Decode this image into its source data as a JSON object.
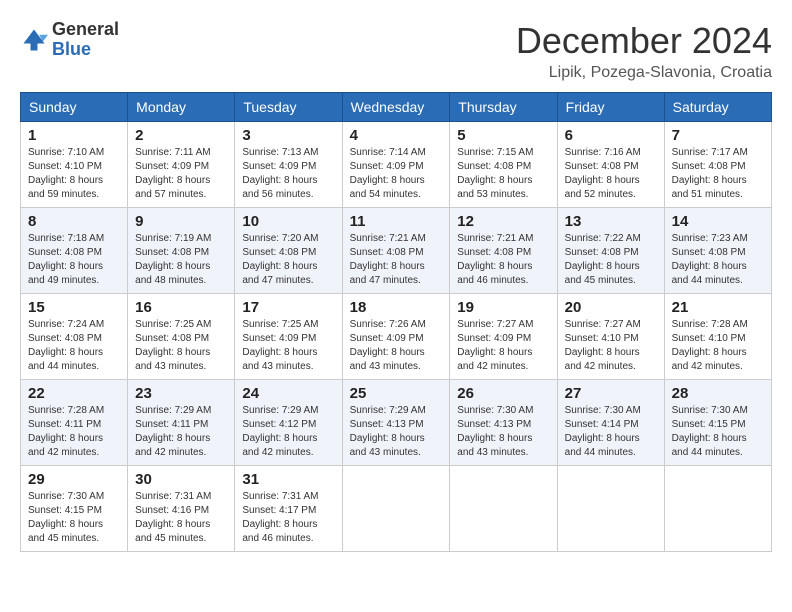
{
  "logo": {
    "general": "General",
    "blue": "Blue"
  },
  "title": "December 2024",
  "location": "Lipik, Pozega-Slavonia, Croatia",
  "days_of_week": [
    "Sunday",
    "Monday",
    "Tuesday",
    "Wednesday",
    "Thursday",
    "Friday",
    "Saturday"
  ],
  "weeks": [
    [
      {
        "day": "1",
        "sunrise": "7:10 AM",
        "sunset": "4:10 PM",
        "daylight": "8 hours and 59 minutes."
      },
      {
        "day": "2",
        "sunrise": "7:11 AM",
        "sunset": "4:09 PM",
        "daylight": "8 hours and 57 minutes."
      },
      {
        "day": "3",
        "sunrise": "7:13 AM",
        "sunset": "4:09 PM",
        "daylight": "8 hours and 56 minutes."
      },
      {
        "day": "4",
        "sunrise": "7:14 AM",
        "sunset": "4:09 PM",
        "daylight": "8 hours and 54 minutes."
      },
      {
        "day": "5",
        "sunrise": "7:15 AM",
        "sunset": "4:08 PM",
        "daylight": "8 hours and 53 minutes."
      },
      {
        "day": "6",
        "sunrise": "7:16 AM",
        "sunset": "4:08 PM",
        "daylight": "8 hours and 52 minutes."
      },
      {
        "day": "7",
        "sunrise": "7:17 AM",
        "sunset": "4:08 PM",
        "daylight": "8 hours and 51 minutes."
      }
    ],
    [
      {
        "day": "8",
        "sunrise": "7:18 AM",
        "sunset": "4:08 PM",
        "daylight": "8 hours and 49 minutes."
      },
      {
        "day": "9",
        "sunrise": "7:19 AM",
        "sunset": "4:08 PM",
        "daylight": "8 hours and 48 minutes."
      },
      {
        "day": "10",
        "sunrise": "7:20 AM",
        "sunset": "4:08 PM",
        "daylight": "8 hours and 47 minutes."
      },
      {
        "day": "11",
        "sunrise": "7:21 AM",
        "sunset": "4:08 PM",
        "daylight": "8 hours and 47 minutes."
      },
      {
        "day": "12",
        "sunrise": "7:21 AM",
        "sunset": "4:08 PM",
        "daylight": "8 hours and 46 minutes."
      },
      {
        "day": "13",
        "sunrise": "7:22 AM",
        "sunset": "4:08 PM",
        "daylight": "8 hours and 45 minutes."
      },
      {
        "day": "14",
        "sunrise": "7:23 AM",
        "sunset": "4:08 PM",
        "daylight": "8 hours and 44 minutes."
      }
    ],
    [
      {
        "day": "15",
        "sunrise": "7:24 AM",
        "sunset": "4:08 PM",
        "daylight": "8 hours and 44 minutes."
      },
      {
        "day": "16",
        "sunrise": "7:25 AM",
        "sunset": "4:08 PM",
        "daylight": "8 hours and 43 minutes."
      },
      {
        "day": "17",
        "sunrise": "7:25 AM",
        "sunset": "4:09 PM",
        "daylight": "8 hours and 43 minutes."
      },
      {
        "day": "18",
        "sunrise": "7:26 AM",
        "sunset": "4:09 PM",
        "daylight": "8 hours and 43 minutes."
      },
      {
        "day": "19",
        "sunrise": "7:27 AM",
        "sunset": "4:09 PM",
        "daylight": "8 hours and 42 minutes."
      },
      {
        "day": "20",
        "sunrise": "7:27 AM",
        "sunset": "4:10 PM",
        "daylight": "8 hours and 42 minutes."
      },
      {
        "day": "21",
        "sunrise": "7:28 AM",
        "sunset": "4:10 PM",
        "daylight": "8 hours and 42 minutes."
      }
    ],
    [
      {
        "day": "22",
        "sunrise": "7:28 AM",
        "sunset": "4:11 PM",
        "daylight": "8 hours and 42 minutes."
      },
      {
        "day": "23",
        "sunrise": "7:29 AM",
        "sunset": "4:11 PM",
        "daylight": "8 hours and 42 minutes."
      },
      {
        "day": "24",
        "sunrise": "7:29 AM",
        "sunset": "4:12 PM",
        "daylight": "8 hours and 42 minutes."
      },
      {
        "day": "25",
        "sunrise": "7:29 AM",
        "sunset": "4:13 PM",
        "daylight": "8 hours and 43 minutes."
      },
      {
        "day": "26",
        "sunrise": "7:30 AM",
        "sunset": "4:13 PM",
        "daylight": "8 hours and 43 minutes."
      },
      {
        "day": "27",
        "sunrise": "7:30 AM",
        "sunset": "4:14 PM",
        "daylight": "8 hours and 44 minutes."
      },
      {
        "day": "28",
        "sunrise": "7:30 AM",
        "sunset": "4:15 PM",
        "daylight": "8 hours and 44 minutes."
      }
    ],
    [
      {
        "day": "29",
        "sunrise": "7:30 AM",
        "sunset": "4:15 PM",
        "daylight": "8 hours and 45 minutes."
      },
      {
        "day": "30",
        "sunrise": "7:31 AM",
        "sunset": "4:16 PM",
        "daylight": "8 hours and 45 minutes."
      },
      {
        "day": "31",
        "sunrise": "7:31 AM",
        "sunset": "4:17 PM",
        "daylight": "8 hours and 46 minutes."
      },
      null,
      null,
      null,
      null
    ]
  ],
  "labels": {
    "sunrise": "Sunrise:",
    "sunset": "Sunset:",
    "daylight": "Daylight:"
  }
}
